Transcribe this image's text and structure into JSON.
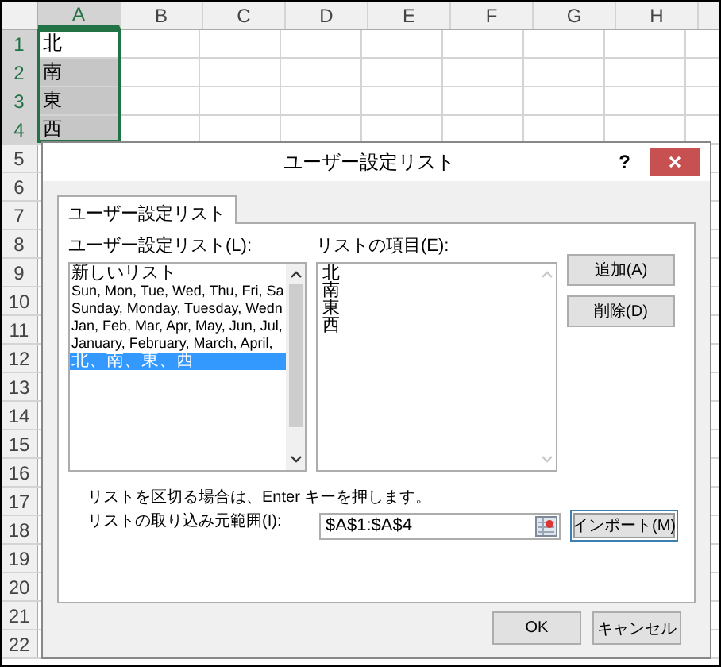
{
  "spreadsheet": {
    "columns": [
      {
        "label": "A",
        "selected": true
      },
      {
        "label": "B",
        "selected": false
      },
      {
        "label": "C",
        "selected": false
      },
      {
        "label": "D",
        "selected": false
      },
      {
        "label": "E",
        "selected": false
      },
      {
        "label": "F",
        "selected": false
      },
      {
        "label": "G",
        "selected": false
      },
      {
        "label": "H",
        "selected": false
      }
    ],
    "rows": [
      {
        "label": "1",
        "selected": true,
        "active": true,
        "cell": "北"
      },
      {
        "label": "2",
        "selected": true,
        "active": false,
        "cell": "南"
      },
      {
        "label": "3",
        "selected": true,
        "active": false,
        "cell": "東"
      },
      {
        "label": "4",
        "selected": true,
        "active": false,
        "cell": "西"
      },
      {
        "label": "5",
        "selected": false
      },
      {
        "label": "6",
        "selected": false
      },
      {
        "label": "7",
        "selected": false
      },
      {
        "label": "8",
        "selected": false
      },
      {
        "label": "9",
        "selected": false
      },
      {
        "label": "10",
        "selected": false
      },
      {
        "label": "11",
        "selected": false
      },
      {
        "label": "12",
        "selected": false
      },
      {
        "label": "13",
        "selected": false
      },
      {
        "label": "14",
        "selected": false
      },
      {
        "label": "15",
        "selected": false
      },
      {
        "label": "16",
        "selected": false
      },
      {
        "label": "17",
        "selected": false
      },
      {
        "label": "18",
        "selected": false
      },
      {
        "label": "19",
        "selected": false
      },
      {
        "label": "20",
        "selected": false
      },
      {
        "label": "21",
        "selected": false
      },
      {
        "label": "22",
        "selected": false
      }
    ]
  },
  "dialog": {
    "title": "ユーザー設定リスト",
    "help": "?",
    "tabs": [
      {
        "label": "ユーザー設定リスト",
        "selected": true
      }
    ],
    "custom_lists": {
      "label": "ユーザー設定リスト(L):",
      "items": [
        {
          "text": "新しいリスト",
          "selected": false
        },
        {
          "text": "Sun, Mon, Tue, Wed, Thu, Fri, Sa",
          "selected": false
        },
        {
          "text": "Sunday, Monday, Tuesday, Wedn",
          "selected": false
        },
        {
          "text": "Jan, Feb, Mar, Apr, May, Jun, Jul,",
          "selected": false
        },
        {
          "text": "January, February, March, April,",
          "selected": false
        },
        {
          "text": "北、南、東、西",
          "selected": true
        }
      ]
    },
    "list_entries": {
      "label": "リストの項目(E):",
      "items": [
        "北",
        "南",
        "東",
        "西"
      ]
    },
    "side_buttons": [
      "追加(A)",
      "削除(D)"
    ],
    "hint": "リストを区切る場合は、Enter キーを押します。",
    "import_range": {
      "label": "リストの取り込み元範囲(I):",
      "value": "$A$1:$A$4"
    },
    "import_button": "インポート(M)",
    "footer_buttons": [
      {
        "label": "OK"
      },
      {
        "label": "キャンセル"
      }
    ]
  }
}
